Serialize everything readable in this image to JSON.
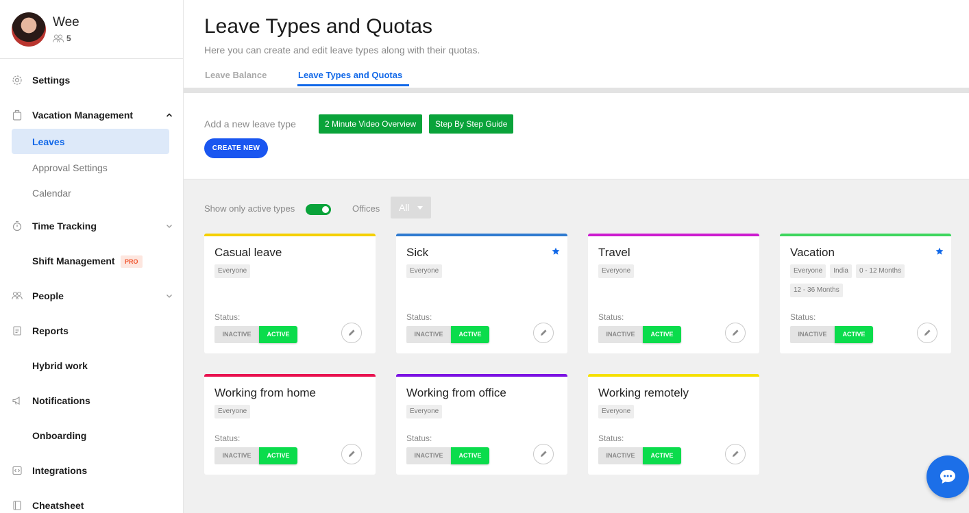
{
  "profile": {
    "name": "Wee",
    "member_count": "5"
  },
  "sidebar": {
    "settings": "Settings",
    "vacation_management": "Vacation Management",
    "leaves": "Leaves",
    "approval_settings": "Approval Settings",
    "calendar": "Calendar",
    "time_tracking": "Time Tracking",
    "shift_management": "Shift Management",
    "pro_badge": "PRO",
    "people": "People",
    "reports": "Reports",
    "hybrid_work": "Hybrid work",
    "notifications": "Notifications",
    "onboarding": "Onboarding",
    "integrations": "Integrations",
    "cheatsheet": "Cheatsheet"
  },
  "header": {
    "title": "Leave Types and Quotas",
    "subtitle": "Here you can create and edit leave types along with their quotas.",
    "tabs": [
      "Leave Balance",
      "Leave Types and Quotas"
    ],
    "active_tab": "Leave Types and Quotas"
  },
  "create": {
    "add_label": "Add a new leave type",
    "video_button": "2 Minute Video Overview",
    "guide_button": "Step By Step Guide",
    "create_button": "CREATE NEW"
  },
  "filters": {
    "active_label": "Show only active types",
    "active_only": true,
    "offices_label": "Offices",
    "offices_value": "All"
  },
  "status_label": "Status:",
  "inactive_label": "INACTIVE",
  "active_label": "ACTIVE",
  "colors": {
    "primary": "#1168e8",
    "green": "#0aa33a",
    "active_green": "#0bdc4c"
  },
  "leave_types": [
    {
      "name": "Casual leave",
      "color": "#f5d000",
      "starred": false,
      "tags": [
        "Everyone"
      ],
      "status": "ACTIVE"
    },
    {
      "name": "Sick",
      "color": "#2f7bd0",
      "starred": true,
      "tags": [
        "Everyone"
      ],
      "status": "ACTIVE"
    },
    {
      "name": "Travel",
      "color": "#cc1ccf",
      "starred": false,
      "tags": [
        "Everyone"
      ],
      "status": "ACTIVE"
    },
    {
      "name": "Vacation",
      "color": "#3ed65e",
      "starred": true,
      "tags": [
        "Everyone",
        "India",
        "0 - 12 Months",
        "12 - 36 Months"
      ],
      "status": "ACTIVE"
    },
    {
      "name": "Working from home",
      "color": "#e8124f",
      "starred": false,
      "tags": [
        "Everyone"
      ],
      "status": "ACTIVE"
    },
    {
      "name": "Working from office",
      "color": "#7b12e2",
      "starred": false,
      "tags": [
        "Everyone"
      ],
      "status": "ACTIVE"
    },
    {
      "name": "Working remotely",
      "color": "#f5e000",
      "starred": false,
      "tags": [
        "Everyone"
      ],
      "status": "ACTIVE"
    }
  ]
}
